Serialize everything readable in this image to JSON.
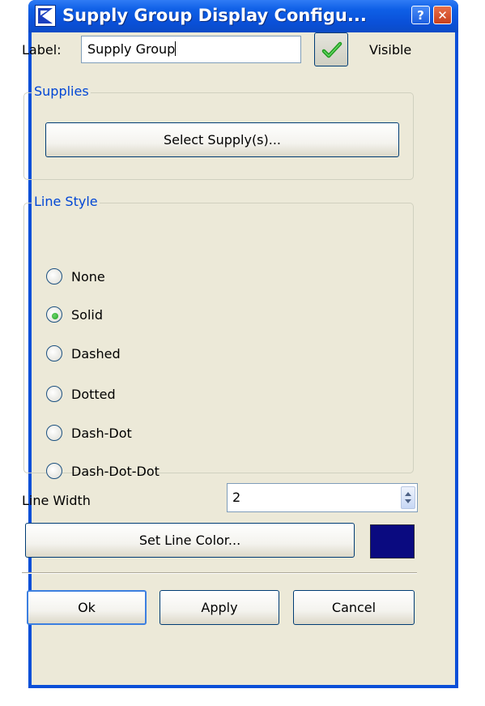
{
  "window": {
    "title": "Supply Group Display Configu...",
    "help_symbol": "?",
    "close_symbol": "✕"
  },
  "label_row": {
    "label": "Label:",
    "value": "Supply Group",
    "visible_label": "Visible",
    "visible_checked": true
  },
  "supplies": {
    "group_title": "Supplies",
    "select_button": "Select Supply(s)..."
  },
  "line_style": {
    "group_title": "Line Style",
    "options": [
      {
        "label": "None",
        "selected": false
      },
      {
        "label": "Solid",
        "selected": true
      },
      {
        "label": "Dashed",
        "selected": false
      },
      {
        "label": "Dotted",
        "selected": false
      },
      {
        "label": "Dash-Dot",
        "selected": false
      },
      {
        "label": "Dash-Dot-Dot",
        "selected": false
      }
    ]
  },
  "line_width": {
    "label": "Line Width",
    "value": "2"
  },
  "line_color": {
    "button": "Set Line Color...",
    "color": "#0a0a80"
  },
  "footer": {
    "ok": "Ok",
    "apply": "Apply",
    "cancel": "Cancel"
  },
  "icons": {
    "app": "app-logo-icon",
    "visible": "checkmark-icon",
    "spinner": "spinner-arrows-icon"
  }
}
